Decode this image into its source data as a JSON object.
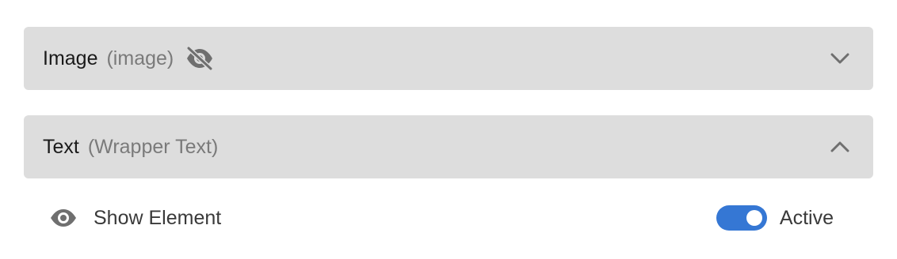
{
  "panels": [
    {
      "title": "Image",
      "subtitle": "(image)",
      "hidden_icon": "eye-off-icon",
      "chevron": "chevron-down-icon",
      "expanded": false
    },
    {
      "title": "Text",
      "subtitle": "(Wrapper Text)",
      "chevron": "chevron-up-icon",
      "expanded": true
    }
  ],
  "visibility_row": {
    "icon": "eye-icon",
    "label": "Show Element",
    "toggle_on": true,
    "toggle_label": "Active"
  },
  "colors": {
    "panel_bg": "#dddddd",
    "toggle_on": "#3577d4",
    "icon_gray": "#6f6f6f",
    "subtitle_gray": "#7a7a7a"
  }
}
